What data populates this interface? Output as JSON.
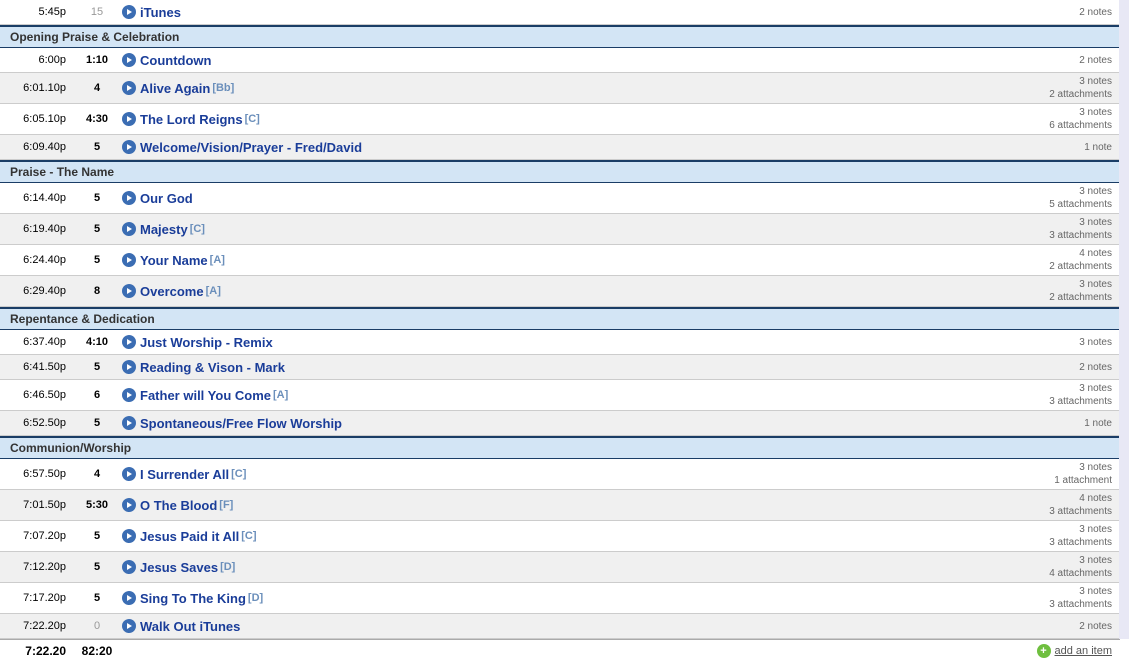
{
  "preItems": [
    {
      "time": "5:45p",
      "dur": "15",
      "durGray": true,
      "title": "iTunes",
      "key": "",
      "notes": "2 notes",
      "attach": "",
      "alt": false
    }
  ],
  "sections": [
    {
      "name": "Opening Praise & Celebration",
      "items": [
        {
          "time": "6:00p",
          "dur": "1:10",
          "title": "Countdown",
          "key": "",
          "notes": "2 notes",
          "attach": "",
          "alt": false
        },
        {
          "time": "6:01.10p",
          "dur": "4",
          "title": "Alive Again",
          "key": "[Bb]",
          "notes": "3 notes",
          "attach": "2 attachments",
          "alt": true
        },
        {
          "time": "6:05.10p",
          "dur": "4:30",
          "title": "The Lord Reigns",
          "key": "[C]",
          "notes": "3 notes",
          "attach": "6 attachments",
          "alt": false
        },
        {
          "time": "6:09.40p",
          "dur": "5",
          "title": "Welcome/Vision/Prayer - Fred/David",
          "key": "",
          "notes": "1 note",
          "attach": "",
          "alt": true
        }
      ]
    },
    {
      "name": "Praise - The Name",
      "items": [
        {
          "time": "6:14.40p",
          "dur": "5",
          "title": "Our God",
          "key": "",
          "notes": "3 notes",
          "attach": "5 attachments",
          "alt": false
        },
        {
          "time": "6:19.40p",
          "dur": "5",
          "title": "Majesty",
          "key": "[C]",
          "notes": "3 notes",
          "attach": "3 attachments",
          "alt": true
        },
        {
          "time": "6:24.40p",
          "dur": "5",
          "title": "Your Name",
          "key": "[A]",
          "notes": "4 notes",
          "attach": "2 attachments",
          "alt": false
        },
        {
          "time": "6:29.40p",
          "dur": "8",
          "title": "Overcome",
          "key": "[A]",
          "notes": "3 notes",
          "attach": "2 attachments",
          "alt": true
        }
      ]
    },
    {
      "name": "Repentance & Dedication",
      "items": [
        {
          "time": "6:37.40p",
          "dur": "4:10",
          "title": "Just Worship - Remix",
          "key": "",
          "notes": "3 notes",
          "attach": "",
          "alt": false
        },
        {
          "time": "6:41.50p",
          "dur": "5",
          "title": "Reading & Vison - Mark",
          "key": "",
          "notes": "2 notes",
          "attach": "",
          "alt": true
        },
        {
          "time": "6:46.50p",
          "dur": "6",
          "title": "Father will You Come",
          "key": "[A]",
          "notes": "3 notes",
          "attach": "3 attachments",
          "alt": false
        },
        {
          "time": "6:52.50p",
          "dur": "5",
          "title": "Spontaneous/Free Flow Worship",
          "key": "",
          "notes": "1 note",
          "attach": "",
          "alt": true
        }
      ]
    },
    {
      "name": "Communion/Worship",
      "items": [
        {
          "time": "6:57.50p",
          "dur": "4",
          "title": "I Surrender All",
          "key": "[C]",
          "notes": "3 notes",
          "attach": "1 attachment",
          "alt": false
        },
        {
          "time": "7:01.50p",
          "dur": "5:30",
          "title": "O The Blood",
          "key": "[F]",
          "notes": "4 notes",
          "attach": "3 attachments",
          "alt": true
        },
        {
          "time": "7:07.20p",
          "dur": "5",
          "title": "Jesus Paid it All",
          "key": "[C]",
          "notes": "3 notes",
          "attach": "3 attachments",
          "alt": false
        },
        {
          "time": "7:12.20p",
          "dur": "5",
          "title": "Jesus Saves",
          "key": "[D]",
          "notes": "3 notes",
          "attach": "4 attachments",
          "alt": true
        },
        {
          "time": "7:17.20p",
          "dur": "5",
          "title": "Sing To The King",
          "key": "[D]",
          "notes": "3 notes",
          "attach": "3 attachments",
          "alt": false
        },
        {
          "time": "7:22.20p",
          "dur": "0",
          "durGray": true,
          "title": "Walk Out iTunes",
          "key": "",
          "notes": "2 notes",
          "attach": "",
          "alt": true
        }
      ]
    }
  ],
  "total": {
    "time": "7:22.20",
    "dur": "82:20"
  },
  "addLabel": "add an item"
}
